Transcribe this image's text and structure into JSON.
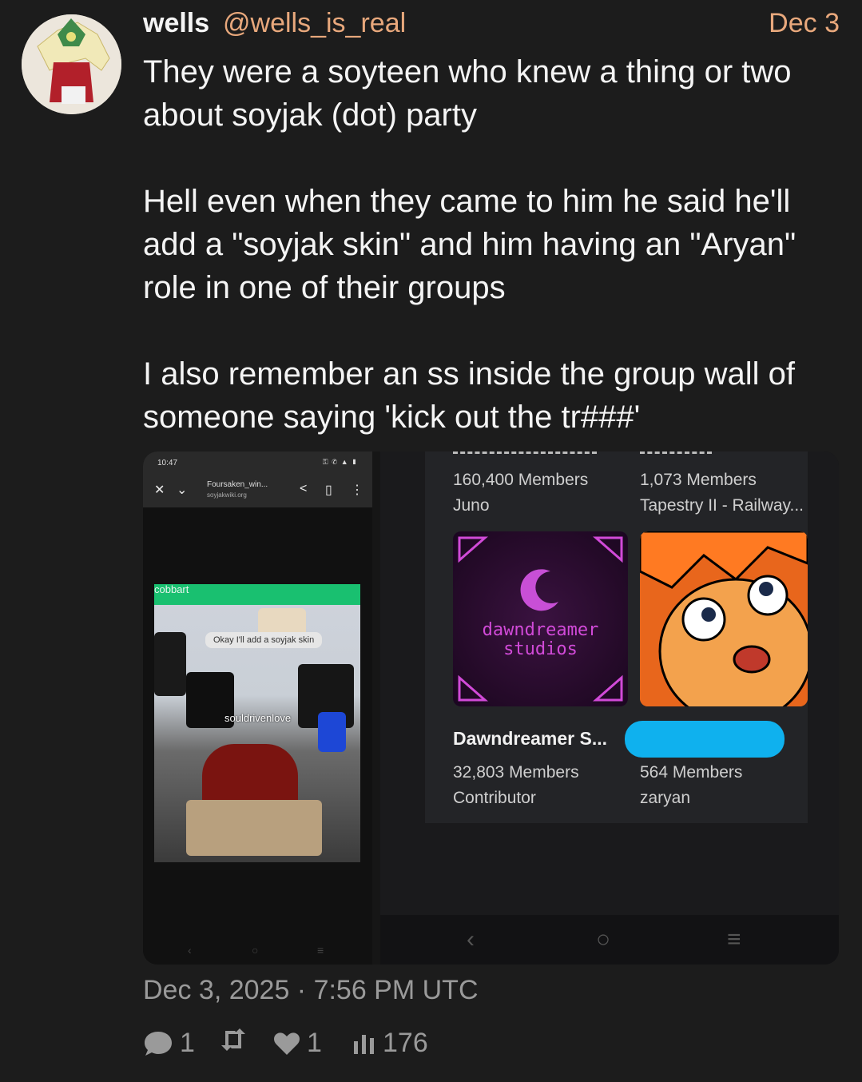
{
  "post": {
    "display_name": "wells",
    "handle": "@wells_is_real",
    "date_short": "Dec 3",
    "paragraphs": [
      "They were a soyteen who knew a thing or two about soyjak (dot) party",
      "Hell even when they came to him he said he'll add a \"soyjak skin\" and him having an \"Aryan\" role in one of their groups",
      "I also remember an ss inside the group wall of someone saying 'kick out the tr###'"
    ],
    "timestamp": "Dec 3, 2025 · 7:56 PM UTC"
  },
  "stats": {
    "replies": "1",
    "reposts": "",
    "likes": "1",
    "views": "176"
  },
  "left_screenshot": {
    "status_time": "10:47",
    "page_title": "Foursaken_win...",
    "page_url": "soyjakwiki.org",
    "username_top": "cobbart",
    "chat_bubble": "Okay I'll add a soyjak skin",
    "username_bottom": "souldrivenlove"
  },
  "right_screenshot": {
    "groups": [
      {
        "members": "160,400 Members",
        "owner": "Juno"
      },
      {
        "members": "1,073 Members",
        "owner": "Tapestry II - Railway..."
      },
      {
        "name": "Dawndreamer S...",
        "members": "32,803 Members",
        "owner": "Contributor"
      },
      {
        "members": "564 Members",
        "owner": "zaryan"
      }
    ],
    "tile_label_line1": "dawndreamer",
    "tile_label_line2": "studios"
  },
  "colors": {
    "accent": "#e8a87c",
    "background": "#1c1c1c",
    "muted": "#9a9a9a",
    "redaction": "#0fb1ee"
  }
}
